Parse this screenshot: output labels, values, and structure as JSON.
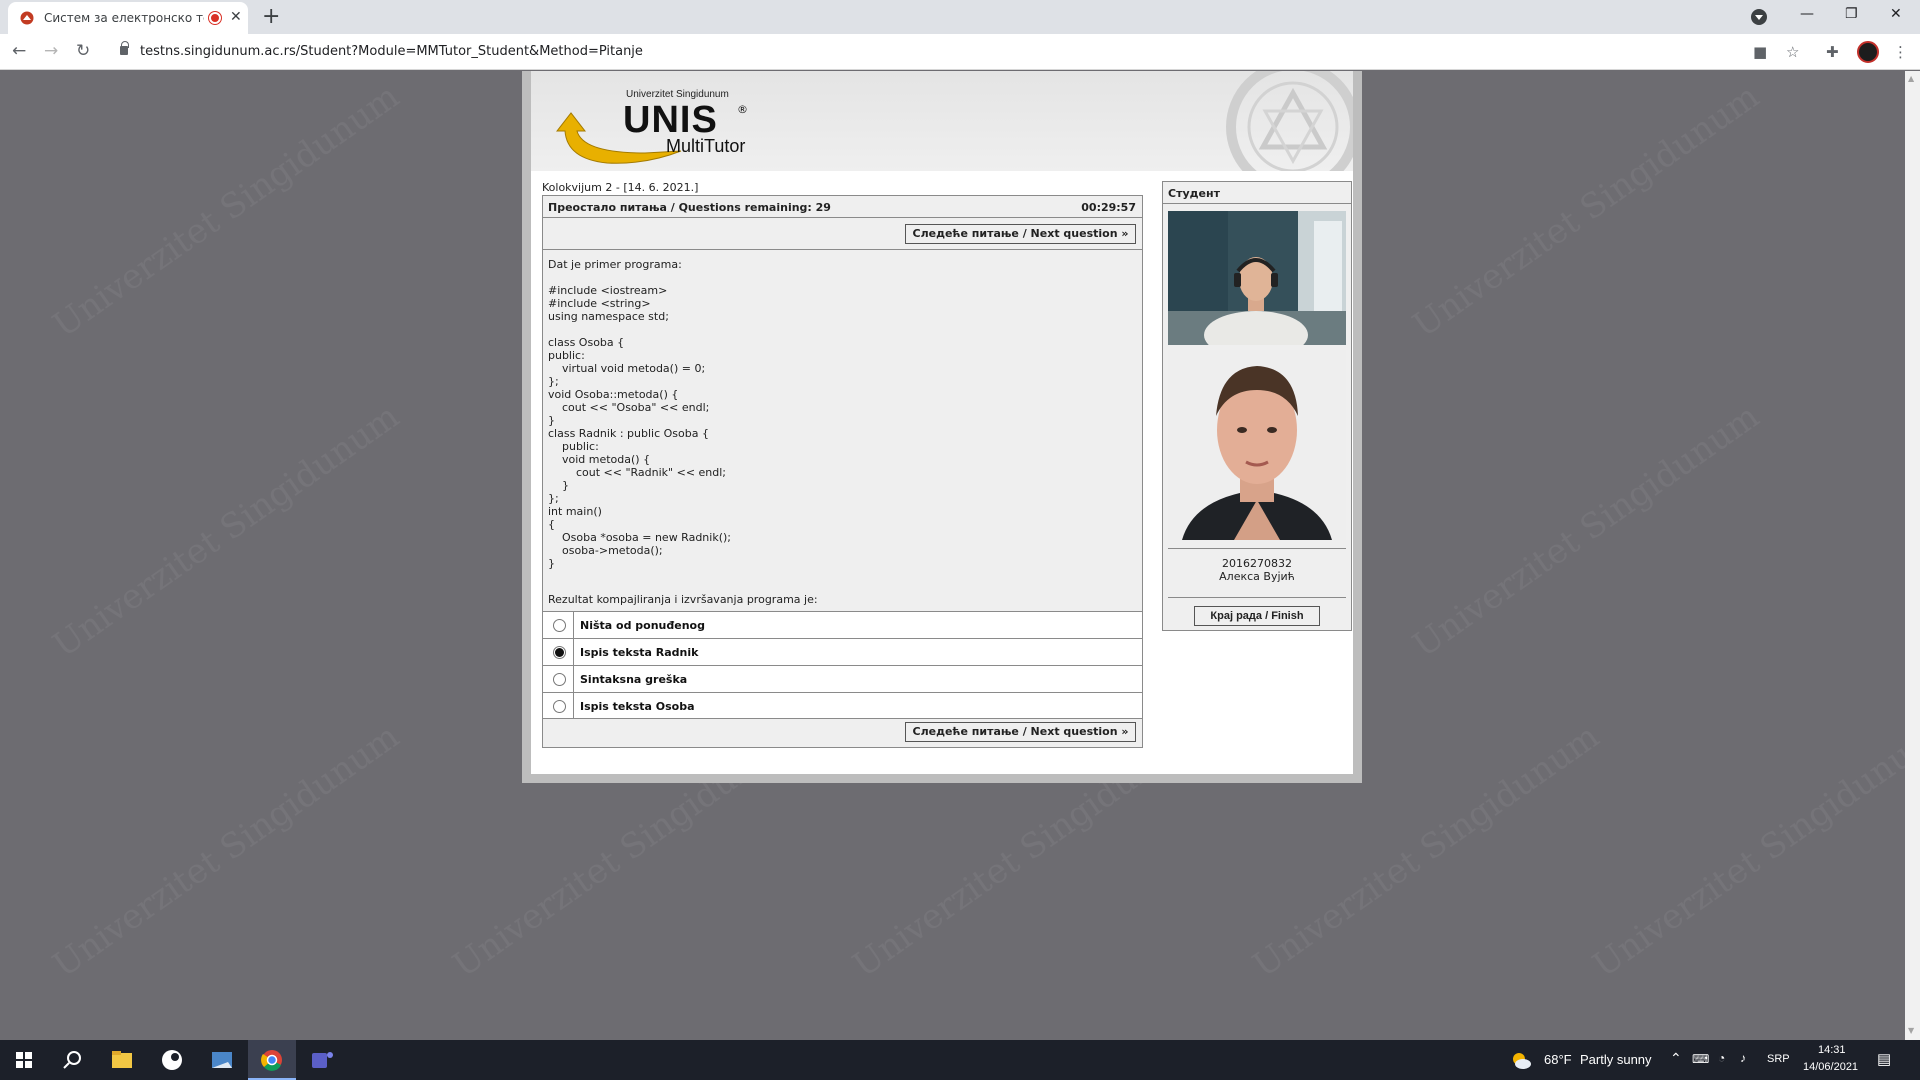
{
  "browser": {
    "tab_title": "Систем за електронско тест",
    "url": "testns.singidunum.ac.rs/Student?Module=MMTutor_Student&Method=Pitanje"
  },
  "logo": {
    "small": "Univerzitet Singidunum",
    "main": "UNIS",
    "reg": "®",
    "sub": "MultiTutor"
  },
  "watermark_text": "Univerzitet Singidunum",
  "exam": {
    "title": "Kolokvijum 2 - [14. 6. 2021.]",
    "remaining": "Преостало питања / Questions remaining: 29",
    "timer": "00:29:57",
    "next_label": "Следеће питање / Next question »",
    "intro": "Dat je primer programa:",
    "code": "#include <iostream>\n#include <string>\nusing namespace std;\n\nclass Osoba {\npublic:\n    virtual void metoda() = 0;\n};\nvoid Osoba::metoda() {\n    cout << \"Osoba\" << endl;\n}\nclass Radnik : public Osoba {\n    public:\n    void metoda() {\n        cout << \"Radnik\" << endl;\n    }\n};\nint main()\n{\n    Osoba *osoba = new Radnik();\n    osoba->metoda();\n}",
    "prompt": "Rezultat kompajliranja i izvršavanja programa je:",
    "answers": [
      {
        "label": "Ništa od ponuđenog",
        "selected": false
      },
      {
        "label": "Ispis teksta Radnik",
        "selected": true
      },
      {
        "label": "Sintaksna greška",
        "selected": false
      },
      {
        "label": "Ispis teksta Osoba",
        "selected": false
      }
    ]
  },
  "student": {
    "header": "Студент",
    "id": "2016270832",
    "name": "Алекса Вујић",
    "finish_label": "Крај рада / Finish"
  },
  "taskbar": {
    "weather_temp": "68°F",
    "weather_desc": "Partly sunny",
    "lang": "SRP",
    "time": "14:31",
    "date": "14/06/2021"
  },
  "colors": {
    "page_bg": "#6d6c71",
    "panel_bg": "#efefef",
    "accent_arrow": "#e8b000"
  }
}
